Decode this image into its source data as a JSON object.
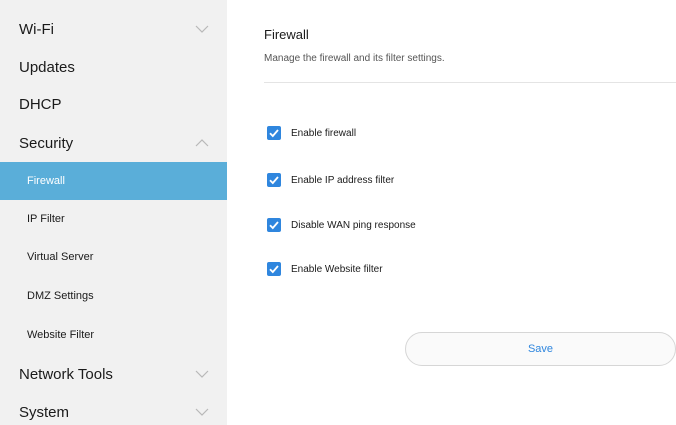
{
  "theme": {
    "sidebar_bg": "#f1f1f1",
    "active_bg": "#5aaed9",
    "accent": "#2f86de"
  },
  "sidebar": {
    "wifi": {
      "label": "Wi-Fi",
      "icon": "chevron-down-icon"
    },
    "updates": {
      "label": "Updates"
    },
    "dhcp": {
      "label": "DHCP"
    },
    "security": {
      "label": "Security",
      "icon": "chevron-up-icon",
      "expanded": true,
      "items": [
        {
          "label": "Firewall",
          "active": true
        },
        {
          "label": "IP Filter"
        },
        {
          "label": "Virtual Server"
        },
        {
          "label": "DMZ Settings"
        },
        {
          "label": "Website Filter"
        }
      ]
    },
    "network_tools": {
      "label": "Network Tools",
      "icon": "chevron-down-icon"
    },
    "system": {
      "label": "System",
      "icon": "chevron-down-icon"
    }
  },
  "main": {
    "title": "Firewall",
    "subtitle": "Manage the firewall and its filter settings.",
    "options": [
      {
        "label": "Enable firewall",
        "checked": true
      },
      {
        "label": "Enable IP address filter",
        "checked": true
      },
      {
        "label": "Disable WAN ping response",
        "checked": true
      },
      {
        "label": "Enable Website filter",
        "checked": true
      }
    ],
    "save_label": "Save"
  }
}
